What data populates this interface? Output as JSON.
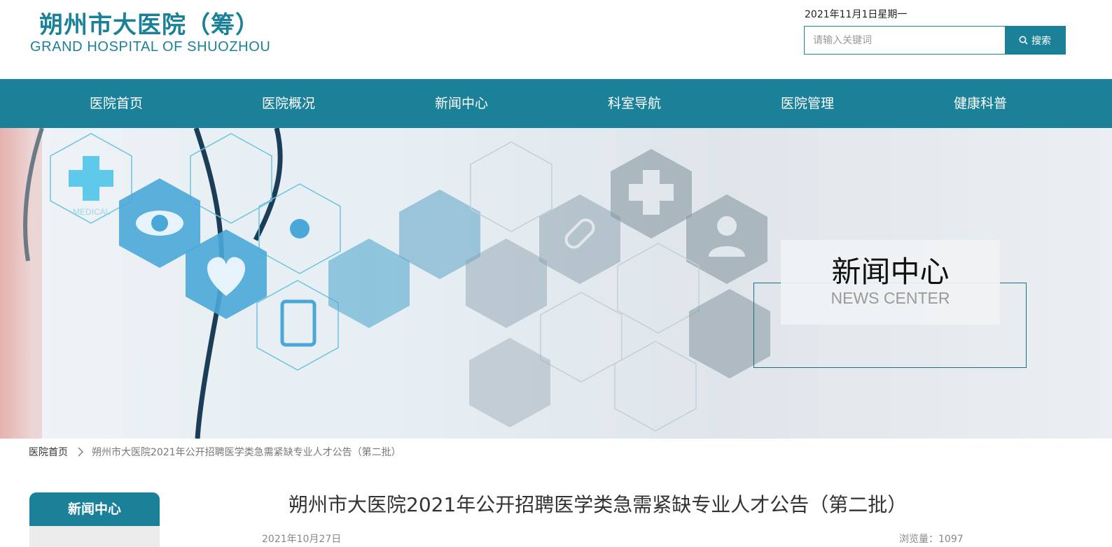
{
  "header": {
    "logo_cn": "朔州市大医院（筹）",
    "logo_en": "GRAND HOSPITAL OF SHUOZHOU",
    "date": "2021年11月1日星期一",
    "search_placeholder": "请输入关键词",
    "search_button": "搜索"
  },
  "nav": {
    "items": [
      "医院首页",
      "医院概况",
      "新闻中心",
      "科室导航",
      "医院管理",
      "健康科普"
    ]
  },
  "banner": {
    "title_cn": "新闻中心",
    "title_en": "NEWS CENTER",
    "hex_text_1": "MEDICAL"
  },
  "breadcrumb": {
    "home": "医院首页",
    "current": "朔州市大医院2021年公开招聘医学类急需紧缺专业人才公告（第二批）"
  },
  "sidebar": {
    "heading": "新闻中心"
  },
  "article": {
    "title": "朔州市大医院2021年公开招聘医学类急需紧缺专业人才公告（第二批）",
    "date": "2021年10月27日",
    "views": "浏览量：1097"
  },
  "colors": {
    "brand": "#1b8199",
    "nav_bg": "#1b8199"
  }
}
